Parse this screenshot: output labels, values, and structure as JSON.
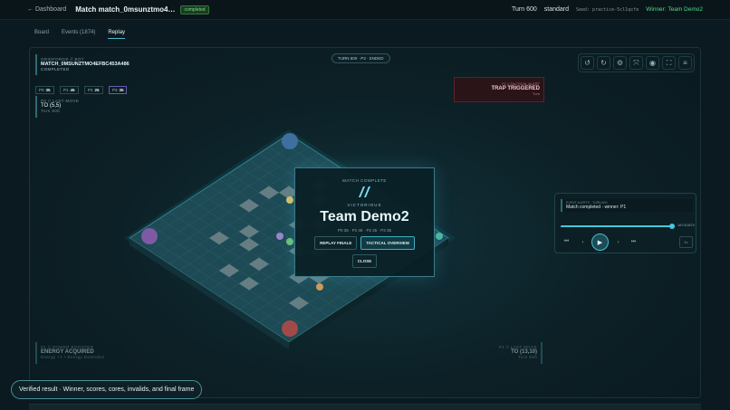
{
  "topbar": {
    "back": "← Dashboard",
    "title": "Match match_0msunztmo4…",
    "status": "completed",
    "turn": "Turn 600",
    "mode": "standard",
    "seed": "Seed: practice-5cl1qcfe",
    "winner": "Winner: Team Demo2"
  },
  "tabs": [
    {
      "label": "Board"
    },
    {
      "label": "Events (1874)"
    },
    {
      "label": "Replay"
    }
  ],
  "hud": {
    "brand": "GRIDFORGE // BOT",
    "match_id": "MATCH_0MSUNZTMO4EFBC453A486",
    "state": "COMPLETED",
    "scores": [
      {
        "label": "P0",
        "value": "35"
      },
      {
        "label": "P1",
        "value": "45"
      },
      {
        "label": "P2",
        "value": "25"
      },
      {
        "label": "P3",
        "value": "35"
      }
    ],
    "last_move_key": "P0 // LAST MOVE",
    "last_move": "TO (5,5)",
    "last_move_sub": "Turn 600",
    "turn_pill": "TURN 600 · P3 · ENDED"
  },
  "alerts": {
    "tactical_key": "P1 // TACTICAL ALERT",
    "tactical_value": "TRAP TRIGGERED",
    "tactical_sub": "Turn",
    "power_key": "P1 // POWER BOOSTER",
    "power_value": "ENERGY ACQUIRED",
    "power_sub": "Energy +1 • Energy Extended",
    "last_move2_key": "P1 // LAST MOVE",
    "last_move2_value": "TO (13,10)",
    "last_move2_sub": "Turn 600"
  },
  "modal": {
    "header": "MATCH COMPLETE",
    "result": "VICTORIOUS",
    "team": "Team Demo2",
    "scoreline": "P0 35 · P1 45 · P2 25 · P3 35",
    "replay_label": "REPLAY FINALE",
    "tactical_label": "TACTICAL OVERVIEW",
    "close_label": "CLOSE"
  },
  "controls": {
    "event_key": "EVENT ALERTS · TURN 600",
    "event_value": "Match completed - winner: P1",
    "progress": 1.0,
    "progress_text": "1874/1874",
    "speed": "1×"
  },
  "toast": "Verified result · Winner, scores, cores, invalids, and final frame",
  "colors": {
    "accent": "#49c7dd",
    "winner": "#4fdc8a",
    "alert": "#5a2228"
  }
}
